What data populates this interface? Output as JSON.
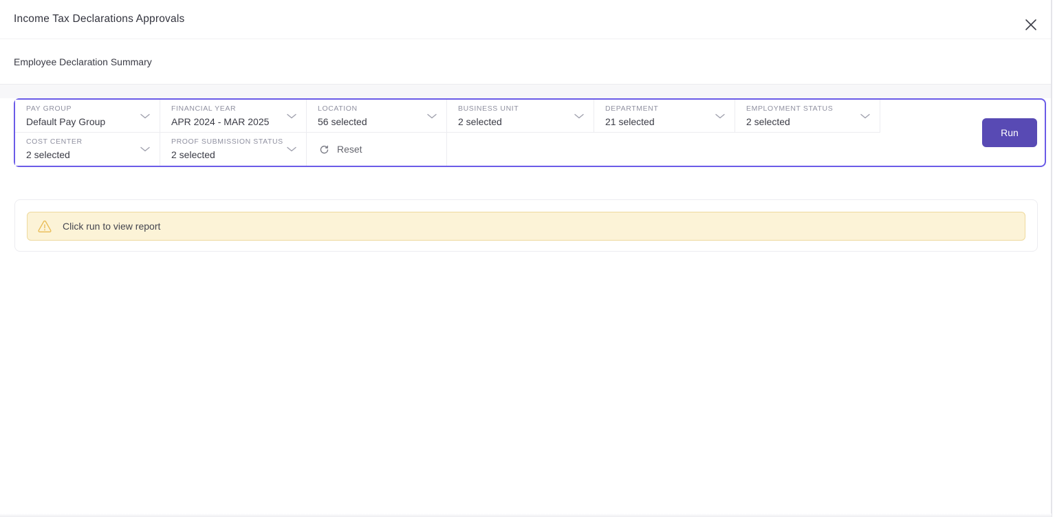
{
  "window": {
    "title": "Income Tax Declarations Approvals"
  },
  "page": {
    "subtitle": "Employee Declaration Summary"
  },
  "filters": {
    "fields": [
      {
        "label": "PAY GROUP",
        "value": "Default Pay Group"
      },
      {
        "label": "FINANCIAL YEAR",
        "value": "APR 2024 - MAR 2025"
      },
      {
        "label": "LOCATION",
        "value": "56 selected"
      },
      {
        "label": "BUSINESS UNIT",
        "value": "2 selected"
      },
      {
        "label": "DEPARTMENT",
        "value": "21 selected"
      },
      {
        "label": "EMPLOYMENT STATUS",
        "value": "2 selected"
      },
      {
        "label": "COST CENTER",
        "value": "2 selected"
      },
      {
        "label": "PROOF SUBMISSION STATUS",
        "value": "2 selected"
      }
    ],
    "reset_label": "Reset",
    "run_label": "Run"
  },
  "notice": {
    "message": "Click run to view report"
  },
  "icons": {
    "close": "close-icon",
    "chevron": "chevron-down-icon",
    "reset": "refresh-icon",
    "warning": "warning-triangle-icon"
  },
  "colors": {
    "accent_border": "#6a5be7",
    "run_button": "#584ab4",
    "warning_bg": "#fcf3d7",
    "warning_border": "#eed99d",
    "warning_icon": "#e9bb54",
    "label_gray": "#8f90a0",
    "value_dark": "#3a3b45"
  }
}
